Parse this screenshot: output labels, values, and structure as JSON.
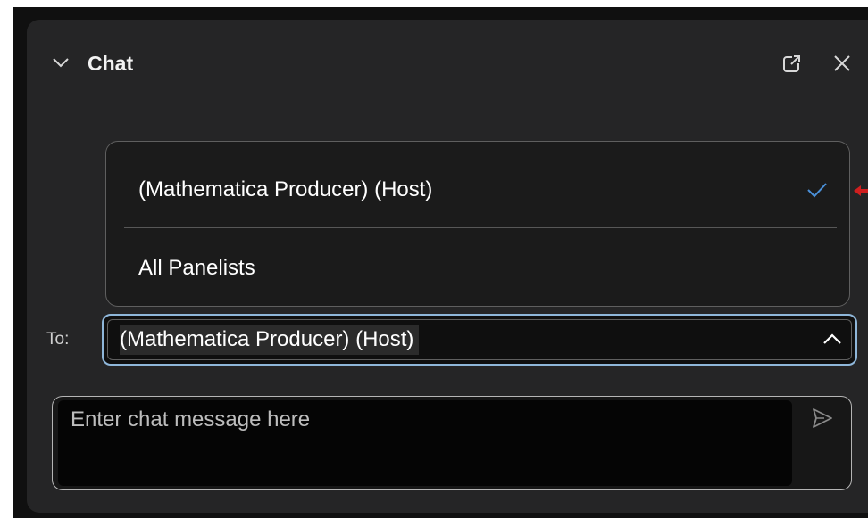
{
  "header": {
    "title": "Chat",
    "collapse_icon": "chevron-down-icon",
    "popout_icon": "popout-icon",
    "close_icon": "close-icon"
  },
  "dropdown": {
    "items": [
      {
        "label": "(Mathematica Producer) (Host)",
        "selected": true
      },
      {
        "label": "All Panelists",
        "selected": false
      }
    ],
    "check_icon": "check-icon",
    "accent_color": "#4a90d9",
    "annotation_color": "#d01f1f"
  },
  "to_field": {
    "label": "To:",
    "value": "(Mathematica Producer) (Host)",
    "expanded": true,
    "chevron_icon": "chevron-up-icon"
  },
  "message": {
    "placeholder": "Enter chat message here",
    "value": "",
    "send_icon": "send-icon"
  }
}
